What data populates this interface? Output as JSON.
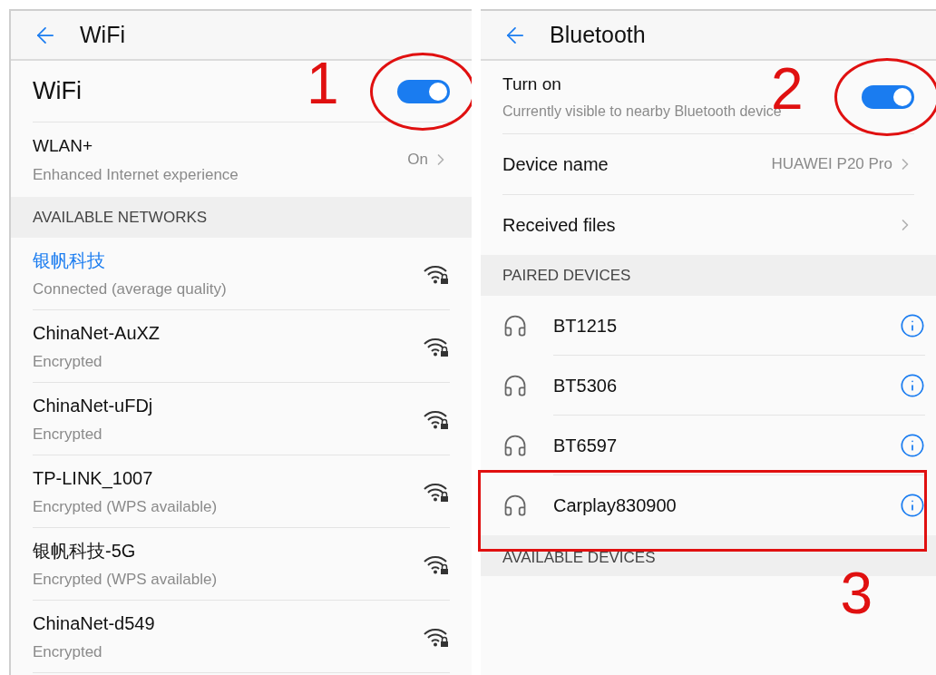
{
  "wifi": {
    "title": "WiFi",
    "toggle": {
      "label": "WiFi",
      "on": true,
      "annotation": "1"
    },
    "wlan_plus": {
      "label": "WLAN+",
      "subtitle": "Enhanced Internet experience",
      "value": "On"
    },
    "section": "AVAILABLE NETWORKS",
    "networks": [
      {
        "name": "银帆科技",
        "status": "Connected (average quality)",
        "connected": true
      },
      {
        "name": "ChinaNet-AuXZ",
        "status": "Encrypted",
        "connected": false
      },
      {
        "name": "ChinaNet-uFDj",
        "status": "Encrypted",
        "connected": false
      },
      {
        "name": "TP-LINK_1007",
        "status": "Encrypted (WPS available)",
        "connected": false
      },
      {
        "name": "银帆科技-5G",
        "status": "Encrypted (WPS available)",
        "connected": false
      },
      {
        "name": "ChinaNet-d549",
        "status": "Encrypted",
        "connected": false
      }
    ]
  },
  "bluetooth": {
    "title": "Bluetooth",
    "toggle": {
      "label": "Turn on",
      "subtitle": "Currently visible to nearby Bluetooth device",
      "on": true,
      "annotation": "2"
    },
    "device_name": {
      "label": "Device name",
      "value": "HUAWEI P20 Pro"
    },
    "received_files": {
      "label": "Received files"
    },
    "paired_section": "PAIRED DEVICES",
    "paired": [
      {
        "name": "BT1215",
        "highlighted": false
      },
      {
        "name": "BT5306",
        "highlighted": false
      },
      {
        "name": "BT6597",
        "highlighted": false
      },
      {
        "name": "Carplay830900",
        "highlighted": true,
        "annotation": "3"
      }
    ],
    "available_section": "AVAILABLE DEVICES"
  }
}
